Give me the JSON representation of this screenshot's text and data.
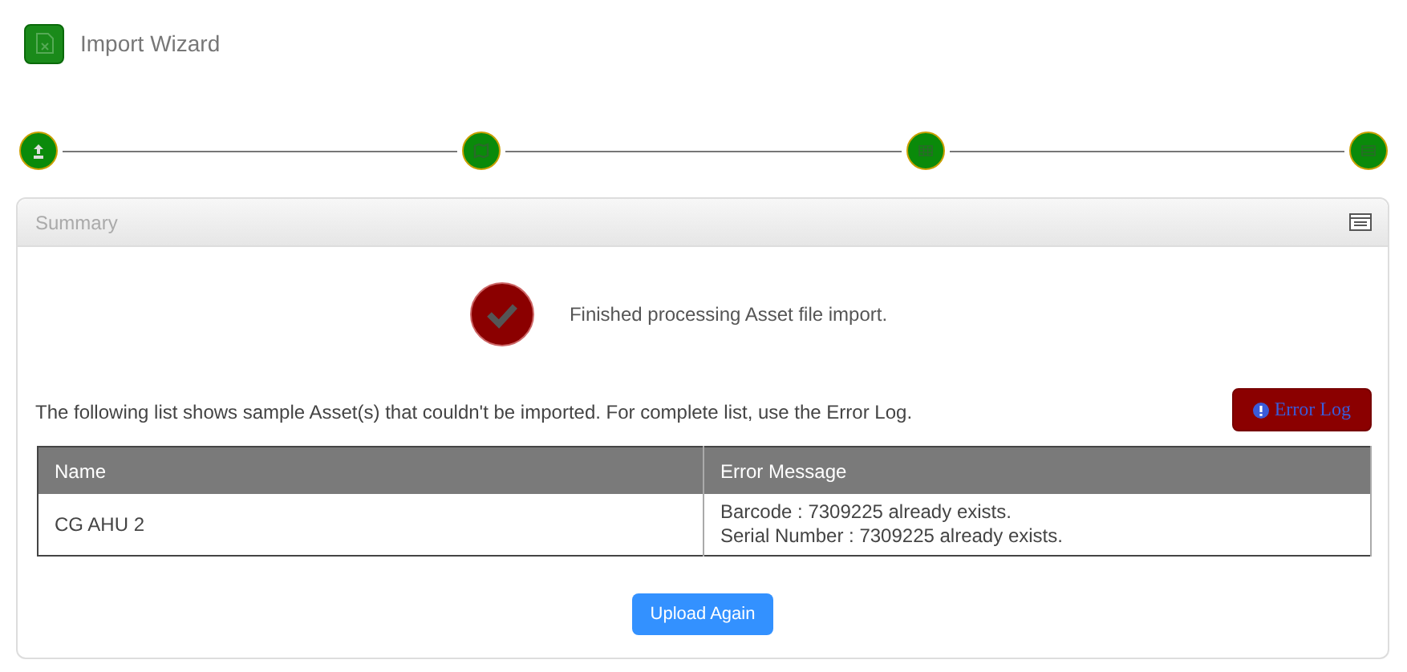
{
  "header": {
    "title": "Import Wizard"
  },
  "steps": [
    {
      "kind": "upload"
    },
    {
      "kind": "map"
    },
    {
      "kind": "grid"
    },
    {
      "kind": "list"
    }
  ],
  "panel": {
    "title": "Summary",
    "status_message": "Finished processing Asset file import.",
    "description": "The following list shows sample Asset(s) that couldn't be imported. For complete list, use the Error Log.",
    "error_log_button": "Error Log",
    "table": {
      "columns": [
        "Name",
        "Error Message"
      ],
      "rows": [
        {
          "name": "CG AHU 2",
          "errors": [
            "Barcode : 7309225 already exists.",
            "Serial Number : 7309225 already exists."
          ]
        }
      ]
    },
    "upload_button": "Upload Again"
  }
}
